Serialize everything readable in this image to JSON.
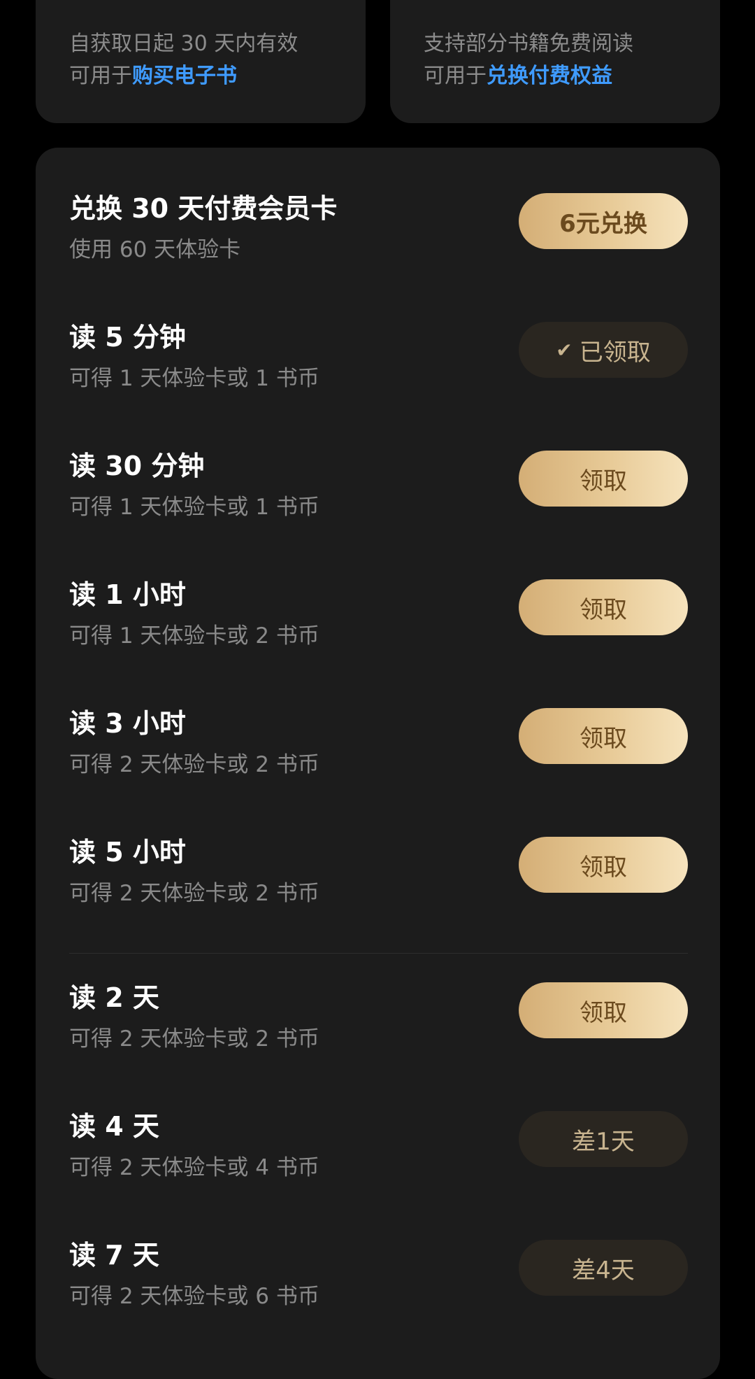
{
  "top_cards": [
    {
      "line1": "自获取日起 30 天内有效",
      "line2_prefix": "可用于",
      "line2_link": "购买电子书"
    },
    {
      "line1": "支持部分书籍免费阅读",
      "line2_prefix": "可用于",
      "line2_link": "兑换付费权益"
    }
  ],
  "tasks": [
    {
      "title": "兑换 30 天付费会员卡",
      "subtitle": "使用 60 天体验卡",
      "button": "6元兑换"
    },
    {
      "title": "读 5 分钟",
      "subtitle": "可得 1 天体验卡或 1 书币",
      "button": "已领取"
    },
    {
      "title": "读 30 分钟",
      "subtitle": "可得 1 天体验卡或 1 书币",
      "button": "领取"
    },
    {
      "title": "读 1 小时",
      "subtitle": "可得 1 天体验卡或 2 书币",
      "button": "领取"
    },
    {
      "title": "读 3 小时",
      "subtitle": "可得 2 天体验卡或 2 书币",
      "button": "领取"
    },
    {
      "title": "读 5 小时",
      "subtitle": "可得 2 天体验卡或 2 书币",
      "button": "领取"
    },
    {
      "title": "读 2 天",
      "subtitle": "可得 2 天体验卡或 2 书币",
      "button": "领取"
    },
    {
      "title": "读 4 天",
      "subtitle": "可得 2 天体验卡或 4 书币",
      "button": "差1天"
    },
    {
      "title": "读 7 天",
      "subtitle": "可得 2 天体验卡或 6 书币",
      "button": "差4天"
    }
  ],
  "icons": {
    "claimed_check": "checkmark-icon"
  },
  "colors": {
    "accent_gold": "#e8cb98",
    "link_blue": "#3f9bff",
    "card_bg": "#1c1c1c"
  }
}
